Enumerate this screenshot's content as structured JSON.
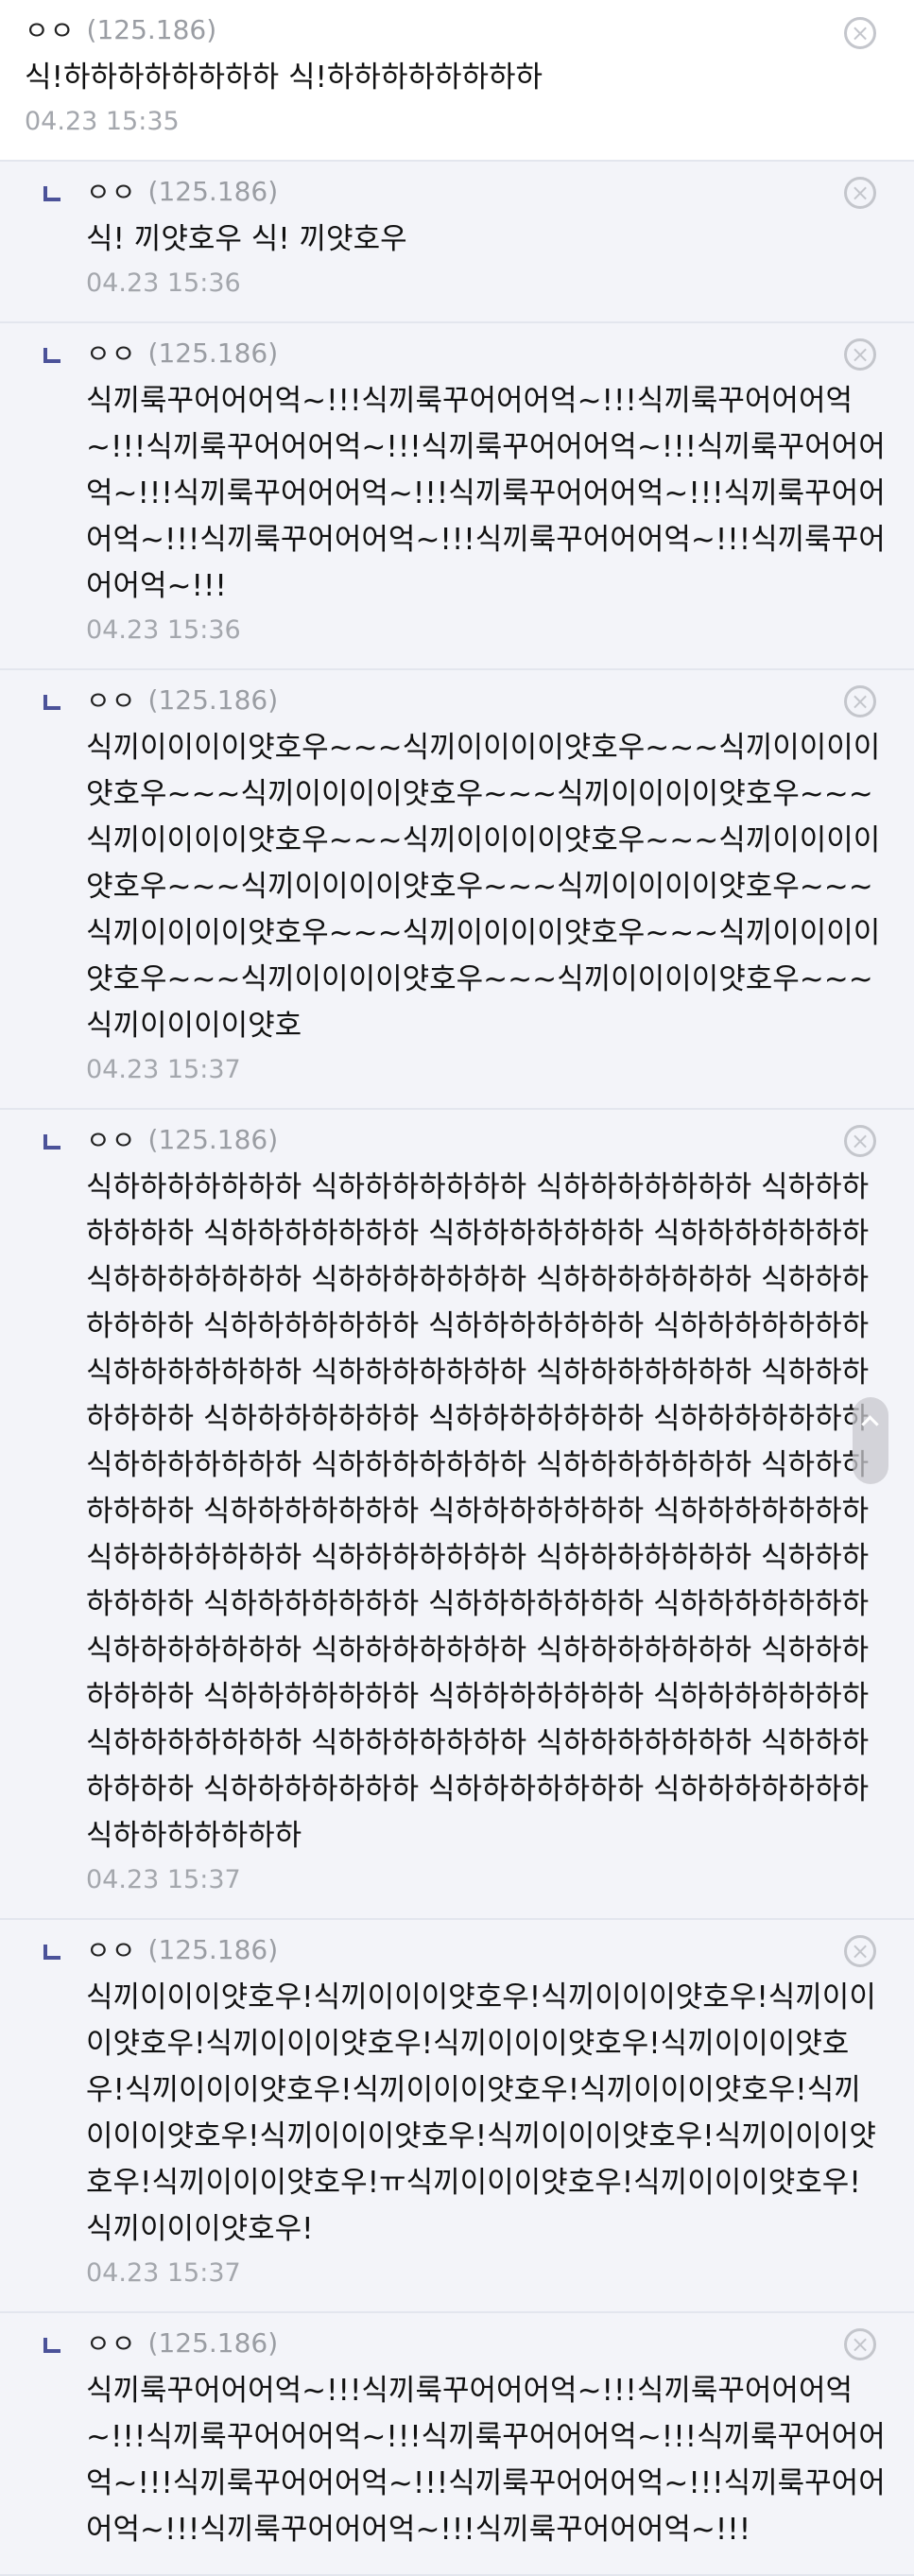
{
  "comments": [
    {
      "nick": "ㅇㅇ",
      "ip": "(125.186)",
      "text": "식!하하하하하하하하 식!하하하하하하하하",
      "date": "04.23 15:35",
      "close_icon": "×"
    },
    {
      "nick": "ㅇㅇ",
      "ip": "(125.186)",
      "text": "식! 끼얏호우 식! 끼얏호우",
      "date": "04.23 15:36",
      "close_icon": "×"
    },
    {
      "nick": "ㅇㅇ",
      "ip": "(125.186)",
      "text": "식끼룩꾸어어어억~!!!식끼룩꾸어어어억~!!!식끼룩꾸어어어억~!!!식끼룩꾸어어어억~!!!식끼룩꾸어어어억~!!!식끼룩꾸어어어억~!!!식끼룩꾸어어어억~!!!식끼룩꾸어어어억~!!!식끼룩꾸어어어억~!!!식끼룩꾸어어어억~!!!식끼룩꾸어어어억~!!!식끼룩꾸어어어억~!!!",
      "date": "04.23 15:36",
      "close_icon": "×"
    },
    {
      "nick": "ㅇㅇ",
      "ip": "(125.186)",
      "text": "식끼이이이이얏호우~~~식끼이이이이얏호우~~~식끼이이이이얏호우~~~식끼이이이이얏호우~~~식끼이이이이얏호우~~~식끼이이이이얏호우~~~식끼이이이이얏호우~~~식끼이이이이얏호우~~~식끼이이이이얏호우~~~식끼이이이이얏호우~~~식끼이이이이얏호우~~~식끼이이이이얏호우~~~식끼이이이이얏호우~~~식끼이이이이얏호우~~~식끼이이이이얏호우~~~식끼이이이이얏호",
      "date": "04.23 15:37",
      "close_icon": "×"
    },
    {
      "nick": "ㅇㅇ",
      "ip": "(125.186)",
      "text": "식하하하하하하하 식하하하하하하하 식하하하하하하하 식하하하하하하하 식하하하하하하하 식하하하하하하하 식하하하하하하하 식하하하하하하하 식하하하하하하하 식하하하하하하하 식하하하하하하하 식하하하하하하하 식하하하하하하하 식하하하하하하하 식하하하하하하하 식하하하하하하하 식하하하하하하하 식하하하하하하하 식하하하하하하하 식하하하하하하하 식하하하하하하하 식하하하하하하하 식하하하하하하하 식하하하하하하하 식하하하하하하하 식하하하하하하하 식하하하하하하하 식하하하하하하하 식하하하하하하하 식하하하하하하하 식하하하하하하하 식하하하하하하하 식하하하하하하하 식하하하하하하하 식하하하하하하하 식하하하하하하하 식하하하하하하하 식하하하하하하하 식하하하하하하하 식하하하하하하하 식하하하하하하하 식하하하하하하하 식하하하하하하하 식하하하하하하하 식하하하하하하하 식하하하하하하하 식하하하하하하하 식하하하하하하하 식하하하하하하하 식하하하하하하하",
      "date": "04.23 15:37",
      "close_icon": "×"
    },
    {
      "nick": "ㅇㅇ",
      "ip": "(125.186)",
      "text": "식끼이이이얏호우!식끼이이이얏호우!식끼이이이얏호우!식끼이이이얏호우!식끼이이이얏호우!식끼이이이얏호우!식끼이이이얏호우!식끼이이이얏호우!식끼이이이얏호우!식끼이이이얏호우!식끼이이이얏호우!식끼이이이얏호우!식끼이이이얏호우!식끼이이이얏호우!식끼이이이얏호우!ㅠ식끼이이이얏호우!식끼이이이얏호우!식끼이이이얏호우!",
      "date": "04.23 15:37",
      "close_icon": "×"
    },
    {
      "nick": "ㅇㅇ",
      "ip": "(125.186)",
      "text": "식끼룩꾸어어어억~!!!식끼룩꾸어어어억~!!!식끼룩꾸어어어억~!!!식끼룩꾸어어어억~!!!식끼룩꾸어어어억~!!!식끼룩꾸어어어억~!!!식끼룩꾸어어어억~!!!식끼룩꾸어어어억~!!!식끼룩꾸어어어억~!!!식끼룩꾸어어어억~!!!식끼룩꾸어어어억~!!!",
      "date": "",
      "close_icon": "×"
    }
  ]
}
